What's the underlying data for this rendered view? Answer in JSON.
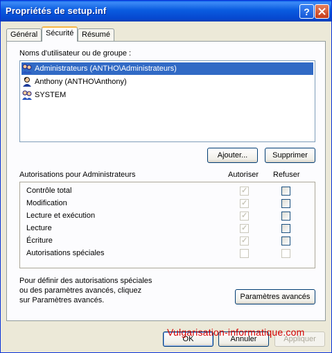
{
  "window": {
    "title": "Propriétés de setup.inf",
    "help": "?",
    "close": "✕"
  },
  "tabs": [
    {
      "label": "Général"
    },
    {
      "label": "Sécurité"
    },
    {
      "label": "Résumé"
    }
  ],
  "users": {
    "label": "Noms d'utilisateur ou de groupe :",
    "items": [
      {
        "name": "Administrateurs (ANTHO\\Administrateurs)",
        "icon": "group-icon"
      },
      {
        "name": "Anthony (ANTHO\\Anthony)",
        "icon": "user-icon"
      },
      {
        "name": "SYSTEM",
        "icon": "group-icon"
      }
    ],
    "add_label": "Ajouter...",
    "remove_label": "Supprimer"
  },
  "permissions": {
    "title": "Autorisations pour Administrateurs",
    "allow_header": "Autoriser",
    "deny_header": "Refuser",
    "rows": [
      {
        "name": "Contrôle total",
        "allow": true,
        "deny": false
      },
      {
        "name": "Modification",
        "allow": true,
        "deny": false
      },
      {
        "name": "Lecture et exécution",
        "allow": true,
        "deny": false
      },
      {
        "name": "Lecture",
        "allow": true,
        "deny": false
      },
      {
        "name": "Écriture",
        "allow": true,
        "deny": false
      },
      {
        "name": "Autorisations spéciales",
        "allow": false,
        "deny": false
      }
    ]
  },
  "advanced": {
    "line1": "Pour définir des autorisations spéciales",
    "line2": "ou des paramètres avancés, cliquez",
    "line3": "sur Paramètres avancés.",
    "button_label": "Paramètres avancés"
  },
  "footer": {
    "ok_label": "OK",
    "cancel_label": "Annuler",
    "apply_label": "Appliquer",
    "watermark": "Vulgarisation-informatique.com"
  },
  "colors": {
    "titlebar": "#0a5ce0",
    "selection": "#316ac5",
    "watermark": "#d40000"
  }
}
